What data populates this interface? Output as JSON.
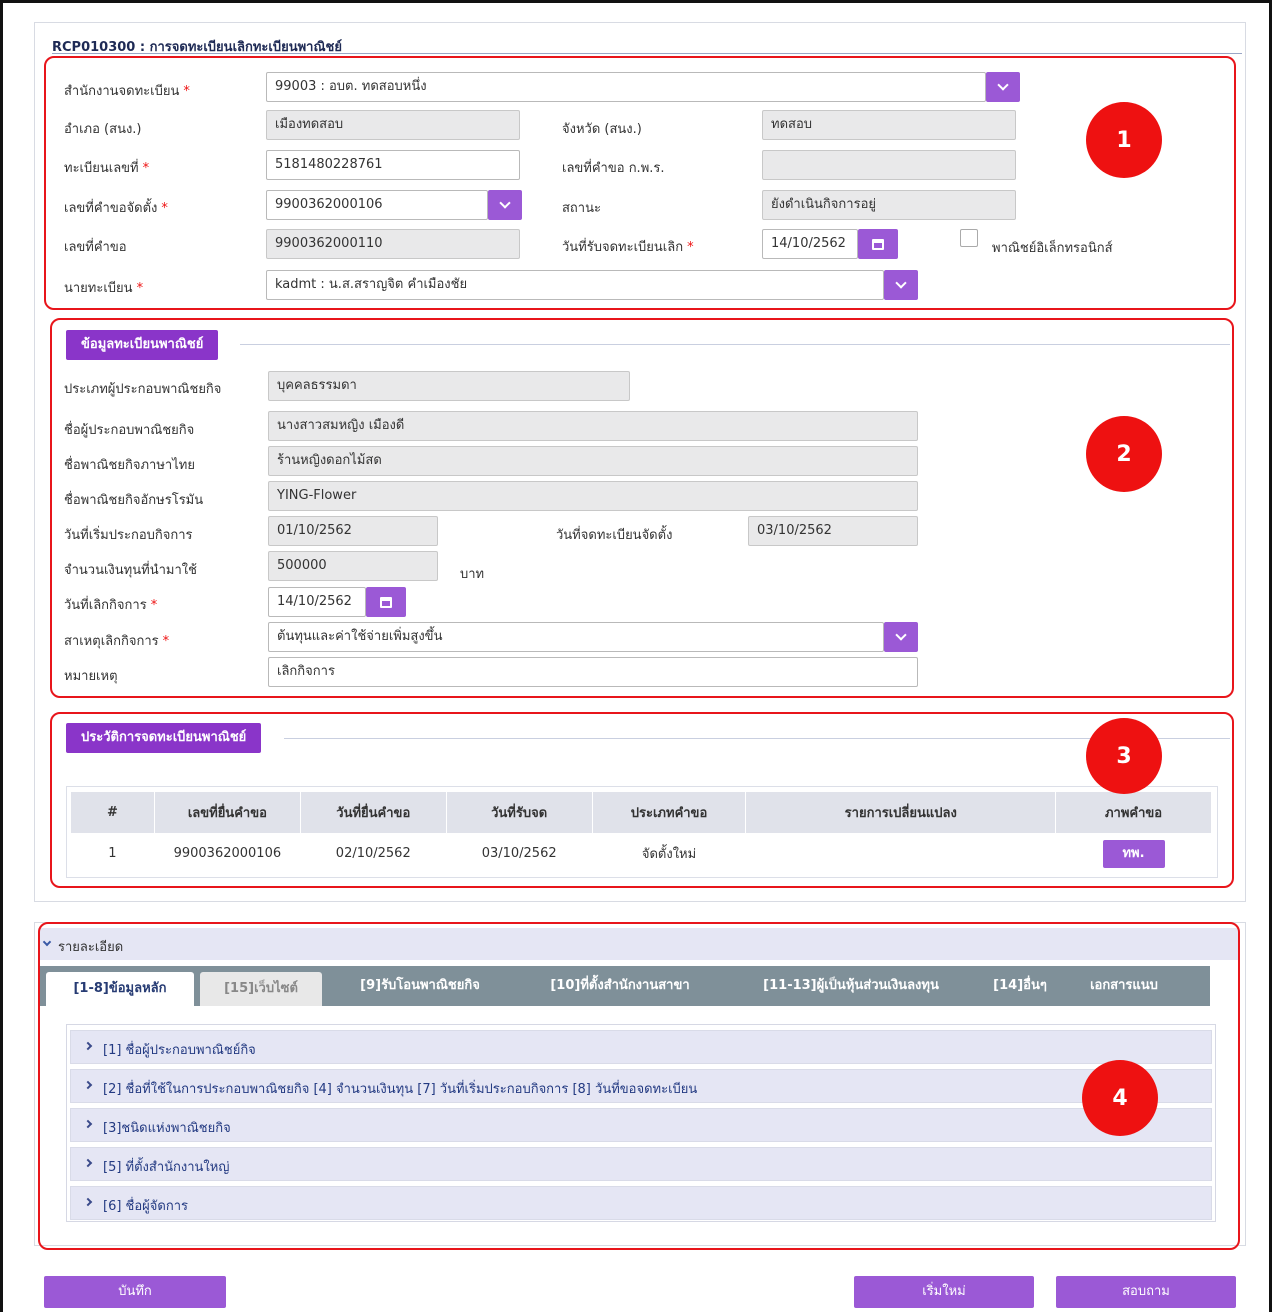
{
  "page": {
    "title": "RCP010300 : การจดทะเบียนเลิกทะเบียนพาณิชย์"
  },
  "section1": {
    "office_label": "สำนักงานจดทะเบียน",
    "office_value": "99003 : อบต. ทดสอบหนึ่ง",
    "district_label": "อำเภอ (สนง.)",
    "district_value": "เมืองทดสอบ",
    "province_label": "จังหวัด (สนง.)",
    "province_value": "ทดสอบ",
    "regno_label": "ทะเบียนเลขที่",
    "regno_value": "5181480228761",
    "kpr_label": "เลขที่คำขอ ก.พ.ร.",
    "kpr_value": "",
    "setup_req_label": "เลขที่คำขอจัดตั้ง",
    "setup_req_value": "9900362000106",
    "status_label": "สถานะ",
    "status_value": "ยังดำเนินกิจการอยู่",
    "req_no_label": "เลขที่คำขอ",
    "req_no_value": "9900362000110",
    "recv_date_label": "วันที่รับจดทะเบียนเลิก",
    "recv_date_value": "14/10/2562",
    "ecommerce_label": "พาณิชย์อิเล็กทรอนิกส์",
    "registrar_label": "นายทะเบียน",
    "registrar_value": "kadmt : น.ส.สราญจิต คำเมืองชัย",
    "required_mark": "*"
  },
  "section2": {
    "header": "ข้อมูลทะเบียนพาณิชย์",
    "type_label": "ประเภทผู้ประกอบพาณิชยกิจ",
    "type_value": "บุคคลธรรมดา",
    "owner_label": "ชื่อผู้ประกอบพาณิชยกิจ",
    "owner_value": "นางสาวสมหญิง เมืองดี",
    "name_th_label": "ชื่อพาณิชยกิจภาษาไทย",
    "name_th_value": "ร้านหญิงดอกไม้สด",
    "name_en_label": "ชื่อพาณิชยกิจอักษรโรมัน",
    "name_en_value": "YING-Flower",
    "start_label": "วันที่เริ่มประกอบกิจการ",
    "start_value": "01/10/2562",
    "setup_date_label": "วันที่จดทะเบียนจัดตั้ง",
    "setup_date_value": "03/10/2562",
    "capital_label": "จำนวนเงินทุนที่นำมาใช้",
    "capital_value": "500000",
    "capital_unit": "บาท",
    "close_date_label": "วันที่เลิกกิจการ",
    "close_date_value": "14/10/2562",
    "reason_label": "สาเหตุเลิกกิจการ",
    "reason_value": "ต้นทุนและค่าใช้จ่ายเพิ่มสูงขึ้น",
    "remark_label": "หมายเหตุ",
    "remark_value": "เลิกกิจการ"
  },
  "section3": {
    "header": "ประวัติการจดทะเบียนพาณิชย์",
    "columns": [
      "#",
      "เลขที่ยื่นคำขอ",
      "วันที่ยื่นคำขอ",
      "วันที่รับจด",
      "ประเภทคำขอ",
      "รายการเปลี่ยนแปลง",
      "ภาพคำขอ"
    ],
    "rows": [
      {
        "no": "1",
        "req_no": "9900362000106",
        "submit_date": "02/10/2562",
        "recv_date": "03/10/2562",
        "type": "จัดตั้งใหม่",
        "changes": "",
        "image_btn": "ทพ."
      }
    ]
  },
  "detail": {
    "header": "รายละเอียด",
    "tabs": [
      "[1-8]ข้อมูลหลัก",
      "[15]เว็บไซต์",
      "[9]รับโอนพาณิชยกิจ",
      "[10]ที่ตั้งสำนักงานสาขา",
      "[11-13]ผู้เป็นหุ้นส่วนเงินลงทุน",
      "[14]อื่นๆ",
      "เอกสารแนบ"
    ],
    "accordions": [
      "[1] ชื่อผู้ประกอบพาณิชย์กิจ",
      "[2] ชื่อที่ใช้ในการประกอบพาณิชยกิจ [4] จำนวนเงินทุน [7] วันที่เริ่มประกอบกิจการ [8] วันที่ขอจดทะเบียน",
      "[3]ชนิดแห่งพาณิชยกิจ",
      "[5] ที่ตั้งสำนักงานใหญ่",
      "[6] ชื่อผู้จัดการ"
    ]
  },
  "badges": [
    "1",
    "2",
    "3",
    "4"
  ],
  "buttons": {
    "save": "บันทึก",
    "reset": "เริ่มใหม่",
    "query": "สอบถาม"
  },
  "colors": {
    "accent": "#9b59d6",
    "section_tab": "#8a35c9",
    "annotation_red": "#e8151b",
    "tabbar": "#7f9099"
  }
}
